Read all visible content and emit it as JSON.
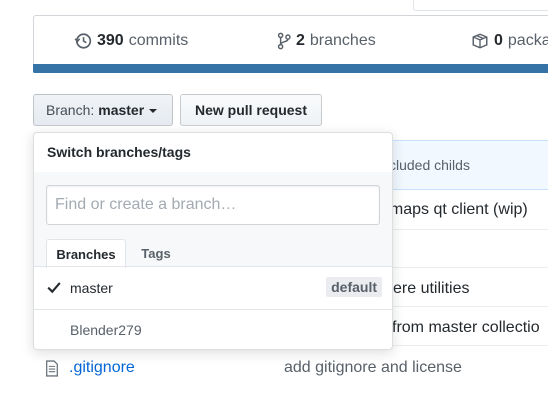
{
  "summary": {
    "commits": {
      "count": "390",
      "label": "commits"
    },
    "branches": {
      "count": "2",
      "label": "branches"
    },
    "packages": {
      "count": "0",
      "label": "packa"
    }
  },
  "toolbar": {
    "branch_label": "Branch:",
    "branch_value": "master",
    "new_pr_label": "New pull request"
  },
  "background": {
    "header_text": "cluded childs",
    "row1_text": "emaps qt client (wip)",
    "row2_text": "ere utilities",
    "row3_text": "from master collectio"
  },
  "file_row": {
    "name": ".gitignore",
    "message": "add gitignore and license"
  },
  "branch_dropdown": {
    "title": "Switch branches/tags",
    "filter_placeholder": "Find or create a branch…",
    "tabs": [
      {
        "label": "Branches",
        "active": true
      },
      {
        "label": "Tags",
        "active": false
      }
    ],
    "items": [
      {
        "name": "master",
        "selected": true,
        "badge": "default"
      },
      {
        "name": "Blender279",
        "selected": false
      }
    ]
  },
  "colors": {
    "language_bar": "#3572a5",
    "link": "#0366d6"
  }
}
